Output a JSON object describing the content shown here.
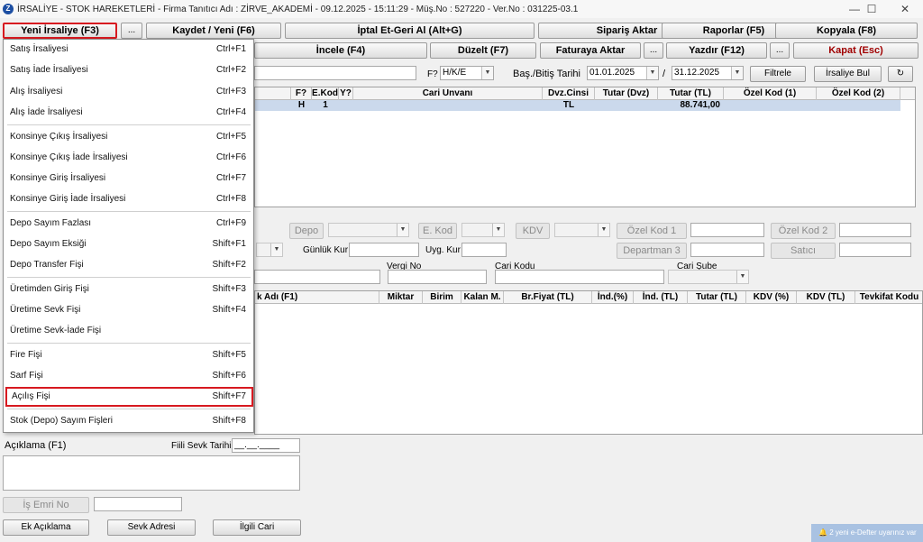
{
  "window": {
    "title": "İRSALİYE - STOK HAREKETLERİ - Firma Tanıtıcı Adı : ZİRVE_AKADEMİ - 09.12.2025 - 15:11:29 - Müş.No : 527220 - Ver.No : 031225-03.1",
    "minimize": "—",
    "maximize": "☐",
    "close": "✕"
  },
  "toolbar": {
    "new_irsaliye": "Yeni İrsaliye (F3)",
    "dots": "...",
    "save_new": "Kaydet / Yeni (F6)",
    "cancel_return": "İptal Et-Geri Al (Alt+G)",
    "order_transfer": "Sipariş Aktar",
    "reports": "Raporlar (F5)",
    "copy": "Kopyala (F8)",
    "inspect": "İncele (F4)",
    "edit": "Düzelt (F7)",
    "invoice_transfer": "Faturaya Aktar",
    "print": "Yazdır (F12)",
    "close": "Kapat (Esc)"
  },
  "filter": {
    "f_label": "F?",
    "f_value": "H/K/E",
    "date_label": "Baş./Bitiş Tarihi",
    "start_date": "01.01.2025",
    "date_sep": "/",
    "end_date": "31.12.2025",
    "filter_btn": "Filtrele",
    "find_btn": "İrsaliye Bul",
    "refresh_icon": "↻"
  },
  "list_grid": {
    "headers": [
      "F?",
      "E.Kod",
      "Y?",
      "Cari Unvanı",
      "Dvz.Cinsi",
      "Tutar (Dvz)",
      "Tutar (TL)",
      "Özel Kod (1)",
      "Özel Kod (2)"
    ],
    "row": {
      "f": "H",
      "ekod": "1",
      "dvz": "TL",
      "tutar_tl": "88.741,00"
    }
  },
  "form": {
    "depo": "Depo",
    "ekod": "E. Kod",
    "kdv": "KDV",
    "ozel_kod_1": "Özel Kod 1",
    "ozel_kod_2": "Özel Kod 2",
    "gunluk_kur": "Günlük Kur",
    "uyg_kur": "Uyg. Kur",
    "departman": "Departman 3",
    "satici": "Satıcı",
    "vergi_no": "Vergi No",
    "cari_kodu": "Cari Kodu",
    "cari_sube": "Cari Şube"
  },
  "detail_grid": {
    "headers": [
      "k Adı (F1)",
      "Miktar",
      "Birim",
      "Kalan M.",
      "Br.Fiyat (TL)",
      "İnd.(%)",
      "İnd. (TL)",
      "Tutar (TL)",
      "KDV (%)",
      "KDV (TL)",
      "Tevkifat Kodu"
    ]
  },
  "bottom": {
    "aciklama": "Açıklama (F1)",
    "fiili_sevk": "Fiili Sevk Tarihi",
    "fiili_sevk_value": "__.__.____",
    "is_emri": "İş Emri No",
    "ek_aciklama": "Ek Açıklama",
    "sevk_adresi": "Sevk Adresi",
    "ilgili_cari": "İlgili Cari"
  },
  "menu": {
    "items": [
      {
        "label": "Satış İrsaliyesi",
        "shortcut": "Ctrl+F1"
      },
      {
        "label": "Satış İade İrsaliyesi",
        "shortcut": "Ctrl+F2"
      },
      {
        "label": "Alış İrsaliyesi",
        "shortcut": "Ctrl+F3"
      },
      {
        "label": "Alış İade İrsaliyesi",
        "shortcut": "Ctrl+F4"
      },
      {
        "label": "Konsinye Çıkış İrsaliyesi",
        "shortcut": "Ctrl+F5"
      },
      {
        "label": "Konsinye Çıkış İade İrsaliyesi",
        "shortcut": "Ctrl+F6"
      },
      {
        "label": "Konsinye Giriş İrsaliyesi",
        "shortcut": "Ctrl+F7"
      },
      {
        "label": "Konsinye Giriş İade İrsaliyesi",
        "shortcut": "Ctrl+F8"
      },
      {
        "label": "Depo Sayım Fazlası",
        "shortcut": "Ctrl+F9"
      },
      {
        "label": "Depo Sayım Eksiği",
        "shortcut": "Shift+F1"
      },
      {
        "label": "Depo Transfer Fişi",
        "shortcut": "Shift+F2"
      },
      {
        "label": "Üretimden Giriş Fişi",
        "shortcut": "Shift+F3"
      },
      {
        "label": "Üretime Sevk Fişi",
        "shortcut": "Shift+F4"
      },
      {
        "label": "Üretime Sevk-İade Fişi",
        "shortcut": ""
      },
      {
        "label": "Fire Fişi",
        "shortcut": "Shift+F5"
      },
      {
        "label": "Sarf Fişi",
        "shortcut": "Shift+F6"
      },
      {
        "label": "Açılış Fişi",
        "shortcut": "Shift+F7"
      },
      {
        "label": "Stok (Depo) Sayım Fişleri",
        "shortcut": "Shift+F8"
      }
    ]
  },
  "notification": "2 yeni e-Defter uyarınız var"
}
